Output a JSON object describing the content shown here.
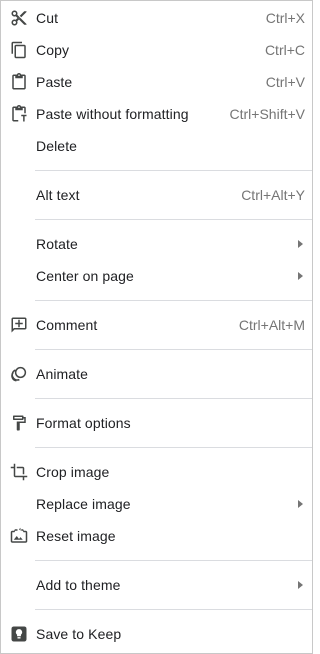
{
  "menu": {
    "cut": {
      "label": "Cut",
      "shortcut": "Ctrl+X",
      "icon": "scissors-icon"
    },
    "copy": {
      "label": "Copy",
      "shortcut": "Ctrl+C",
      "icon": "copy-icon"
    },
    "paste": {
      "label": "Paste",
      "shortcut": "Ctrl+V",
      "icon": "clipboard-icon"
    },
    "paste_plain": {
      "label": "Paste without formatting",
      "shortcut": "Ctrl+Shift+V",
      "icon": "clipboard-text-icon"
    },
    "delete": {
      "label": "Delete"
    },
    "alt_text": {
      "label": "Alt text",
      "shortcut": "Ctrl+Alt+Y"
    },
    "rotate": {
      "label": "Rotate"
    },
    "center": {
      "label": "Center on page"
    },
    "comment": {
      "label": "Comment",
      "shortcut": "Ctrl+Alt+M",
      "icon": "comment-add-icon"
    },
    "animate": {
      "label": "Animate",
      "icon": "animate-icon"
    },
    "format": {
      "label": "Format options",
      "icon": "format-paint-icon"
    },
    "crop": {
      "label": "Crop image",
      "icon": "crop-icon"
    },
    "replace": {
      "label": "Replace image"
    },
    "reset": {
      "label": "Reset image",
      "icon": "reset-image-icon"
    },
    "theme": {
      "label": "Add to theme"
    },
    "keep": {
      "label": "Save to Keep",
      "icon": "keep-icon"
    }
  },
  "colors": {
    "text": "#202124",
    "shortcut": "#757575",
    "divider": "#dadce0",
    "icon": "#444746"
  }
}
